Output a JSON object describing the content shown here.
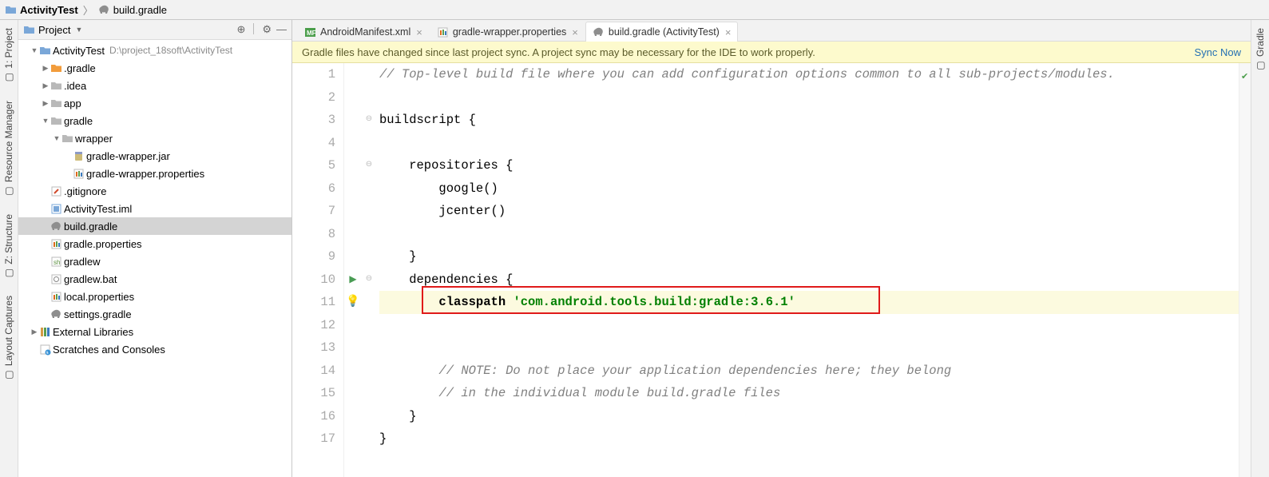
{
  "breadcrumb": {
    "root": "ActivityTest",
    "file": "build.gradle"
  },
  "left_tools": [
    {
      "label": "1: Project",
      "icon": "project"
    },
    {
      "label": "Resource Manager",
      "icon": "resman"
    },
    {
      "label": "Z: Structure",
      "icon": "struct"
    },
    {
      "label": "Layout Captures",
      "icon": "layout"
    }
  ],
  "right_tools": [
    {
      "label": "Gradle",
      "icon": "gradle"
    }
  ],
  "project_panel": {
    "mode": "Project",
    "tools": [
      "target",
      "gear",
      "collapse"
    ]
  },
  "tree": {
    "root": {
      "name": "ActivityTest",
      "path": "D:\\project_18soft\\ActivityTest"
    },
    "items": [
      {
        "depth": 1,
        "icon": "folder-blue",
        "arrow": "▼",
        "label": "ActivityTest",
        "hint": "D:\\project_18soft\\ActivityTest"
      },
      {
        "depth": 2,
        "icon": "folder-orange",
        "arrow": "▶",
        "label": ".gradle"
      },
      {
        "depth": 2,
        "icon": "folder-gray",
        "arrow": "▶",
        "label": ".idea"
      },
      {
        "depth": 2,
        "icon": "folder-gray",
        "arrow": "▶",
        "label": "app"
      },
      {
        "depth": 2,
        "icon": "folder-gray",
        "arrow": "▼",
        "label": "gradle"
      },
      {
        "depth": 3,
        "icon": "folder-gray",
        "arrow": "▼",
        "label": "wrapper"
      },
      {
        "depth": 4,
        "icon": "jar",
        "label": "gradle-wrapper.jar"
      },
      {
        "depth": 4,
        "icon": "props",
        "label": "gradle-wrapper.properties"
      },
      {
        "depth": 2,
        "icon": "gitignore",
        "label": ".gitignore"
      },
      {
        "depth": 2,
        "icon": "iml",
        "label": "ActivityTest.iml"
      },
      {
        "depth": 2,
        "icon": "gradle",
        "label": "build.gradle",
        "selected": true
      },
      {
        "depth": 2,
        "icon": "props",
        "label": "gradle.properties"
      },
      {
        "depth": 2,
        "icon": "sh",
        "label": "gradlew"
      },
      {
        "depth": 2,
        "icon": "bat",
        "label": "gradlew.bat"
      },
      {
        "depth": 2,
        "icon": "props",
        "label": "local.properties"
      },
      {
        "depth": 2,
        "icon": "gradle",
        "label": "settings.gradle"
      },
      {
        "depth": 1,
        "icon": "lib",
        "arrow": "▶",
        "label": "External Libraries"
      },
      {
        "depth": 1,
        "icon": "scratch",
        "label": "Scratches and Consoles"
      }
    ]
  },
  "tabs": [
    {
      "icon": "mf",
      "label": "AndroidManifest.xml",
      "active": false
    },
    {
      "icon": "props",
      "label": "gradle-wrapper.properties",
      "active": false
    },
    {
      "icon": "gradle",
      "label": "build.gradle (ActivityTest)",
      "active": true
    }
  ],
  "banner": {
    "msg": "Gradle files have changed since last project sync. A project sync may be necessary for the IDE to work properly.",
    "action": "Sync Now"
  },
  "code": {
    "highlight_line": 11,
    "run_line": 10,
    "lines": [
      {
        "n": 1,
        "seg": [
          {
            "cls": "c-comment",
            "t": "// Top-level build file where you can add configuration options common to all sub-projects/modules."
          }
        ]
      },
      {
        "n": 2,
        "seg": [
          {
            "cls": "",
            "t": ""
          }
        ]
      },
      {
        "n": 3,
        "seg": [
          {
            "cls": "c-plain",
            "t": "buildscript {"
          }
        ]
      },
      {
        "n": 4,
        "seg": [
          {
            "cls": "",
            "t": ""
          }
        ]
      },
      {
        "n": 5,
        "seg": [
          {
            "cls": "c-plain",
            "t": "    repositories {"
          }
        ]
      },
      {
        "n": 6,
        "seg": [
          {
            "cls": "c-plain",
            "t": "        google()"
          }
        ]
      },
      {
        "n": 7,
        "seg": [
          {
            "cls": "c-plain",
            "t": "        jcenter()"
          }
        ]
      },
      {
        "n": 8,
        "seg": [
          {
            "cls": "",
            "t": ""
          }
        ]
      },
      {
        "n": 9,
        "seg": [
          {
            "cls": "c-plain",
            "t": "    }"
          }
        ]
      },
      {
        "n": 10,
        "seg": [
          {
            "cls": "c-plain",
            "t": "    dependencies {"
          }
        ]
      },
      {
        "n": 11,
        "seg": [
          {
            "cls": "c-plain c-bold",
            "t": "        classpath "
          },
          {
            "cls": "c-str",
            "t": "'com.android.tools.build:gradle:3.6.1'"
          }
        ]
      },
      {
        "n": 12,
        "seg": [
          {
            "cls": "",
            "t": ""
          }
        ]
      },
      {
        "n": 13,
        "seg": [
          {
            "cls": "",
            "t": ""
          }
        ]
      },
      {
        "n": 14,
        "seg": [
          {
            "cls": "c-comment",
            "t": "        // NOTE: Do not place your application dependencies here; they belong"
          }
        ]
      },
      {
        "n": 15,
        "seg": [
          {
            "cls": "c-comment",
            "t": "        // in the individual module build.gradle files"
          }
        ]
      },
      {
        "n": 16,
        "seg": [
          {
            "cls": "c-plain",
            "t": "    }"
          }
        ]
      },
      {
        "n": 17,
        "seg": [
          {
            "cls": "c-plain",
            "t": "}"
          }
        ]
      }
    ],
    "fold_markers": {
      "3": "⊖",
      "5": "⊖",
      "10": "⊖"
    }
  }
}
